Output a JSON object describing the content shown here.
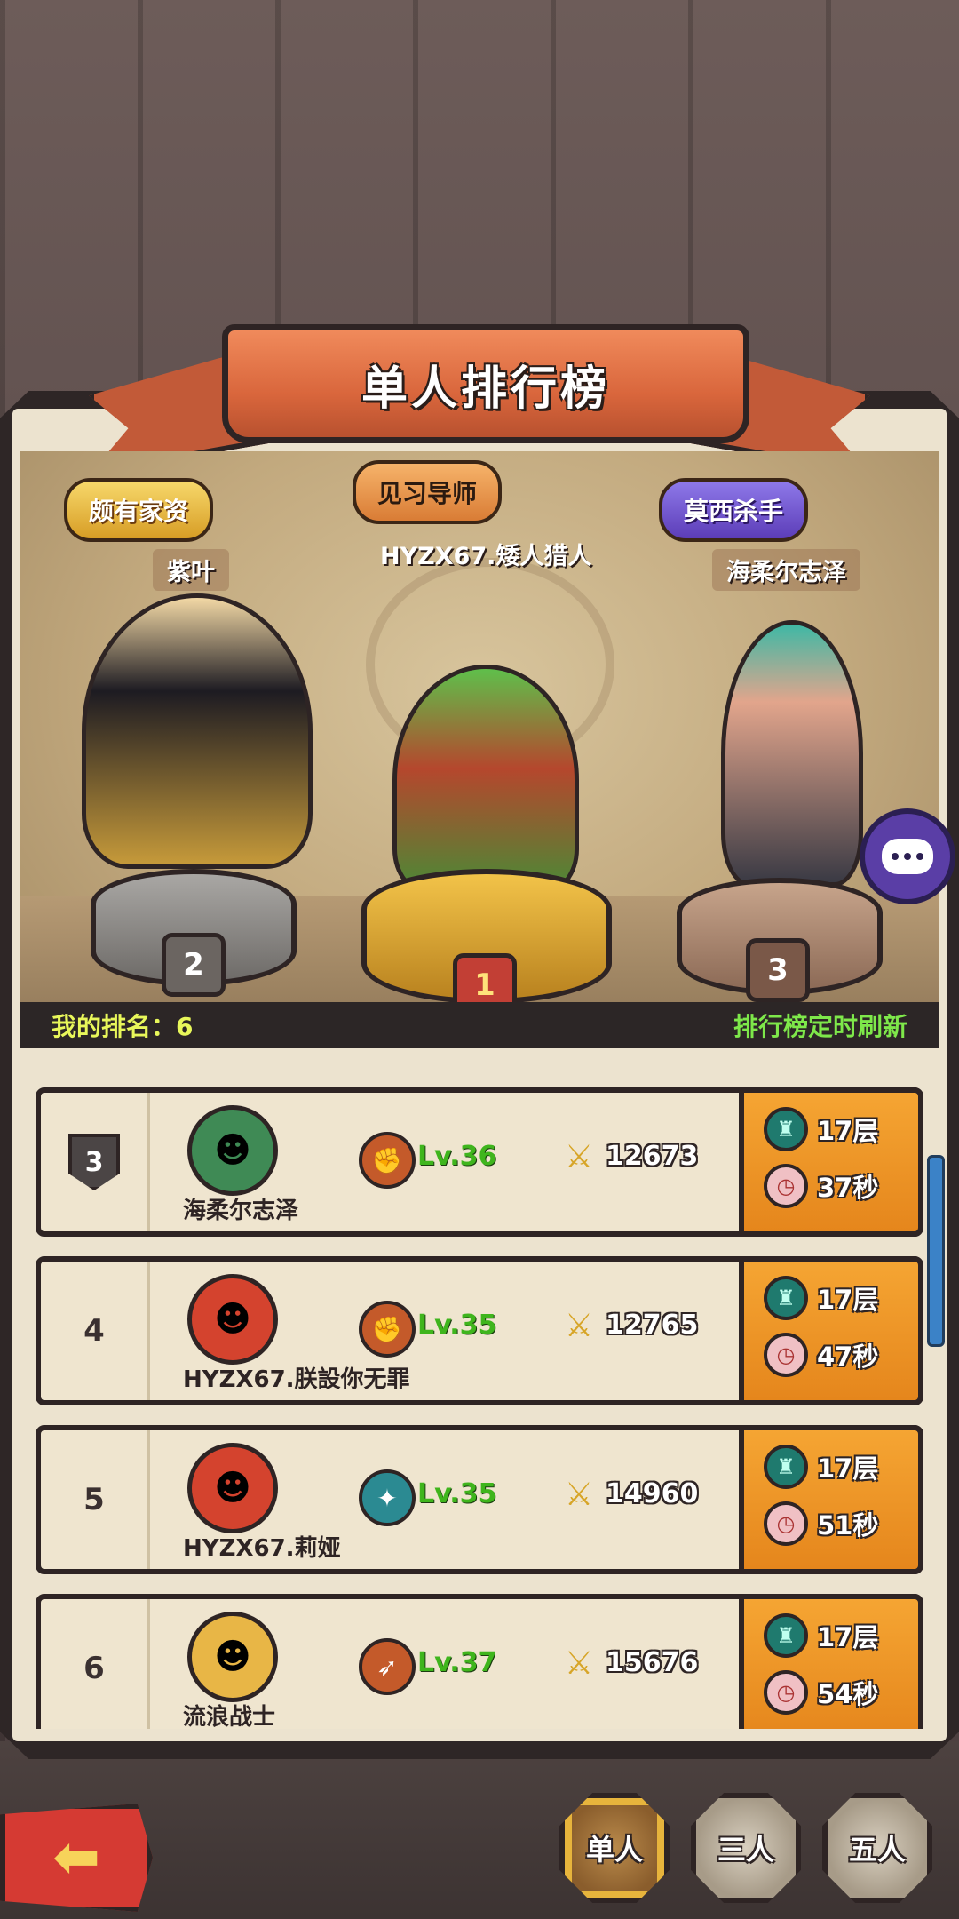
{
  "header": {
    "title": "单人排行榜"
  },
  "podium": {
    "first": {
      "title_badge": "见习导师",
      "name": "HYZX67.矮人猎人",
      "rank": "1"
    },
    "second": {
      "title_badge": "颇有家资",
      "name": "紫叶",
      "rank": "2"
    },
    "third": {
      "title_badge": "莫西杀手",
      "name": "海柔尔志泽",
      "rank": "3"
    },
    "my_rank": "我的排名：6",
    "refresh_note": "排行榜定时刷新"
  },
  "rows": [
    {
      "rank": "3",
      "rank_style": "shield",
      "name": "海柔尔志泽",
      "avatar_icon": "beast-face-icon",
      "class_icon": "gauntlet-icon",
      "level": "Lv.36",
      "power": "12673",
      "floor": "17层",
      "time": "37秒"
    },
    {
      "rank": "4",
      "rank_style": "plain",
      "name": "HYZX67.朕設你无罪",
      "avatar_icon": "red-dragon-icon",
      "class_icon": "gauntlet-icon",
      "level": "Lv.35",
      "power": "12765",
      "floor": "17层",
      "time": "47秒"
    },
    {
      "rank": "5",
      "rank_style": "plain",
      "name": "HYZX67.莉娅",
      "avatar_icon": "red-dragon-icon",
      "class_icon": "shuriken-icon",
      "level": "Lv.35",
      "power": "14960",
      "floor": "17层",
      "time": "51秒"
    },
    {
      "rank": "6",
      "rank_style": "plain",
      "name": "流浪战士",
      "avatar_icon": "bearded-king-icon",
      "class_icon": "dagger-icon",
      "level": "Lv.37",
      "power": "15676",
      "floor": "17层",
      "time": "54秒"
    }
  ],
  "tabs": [
    {
      "label": "单人",
      "active": true
    },
    {
      "label": "三人",
      "active": false
    },
    {
      "label": "五人",
      "active": false
    }
  ],
  "colors": {
    "level_green": "#3fb51d",
    "stat_panel": "#f5a533",
    "banner": "#d9663c"
  }
}
